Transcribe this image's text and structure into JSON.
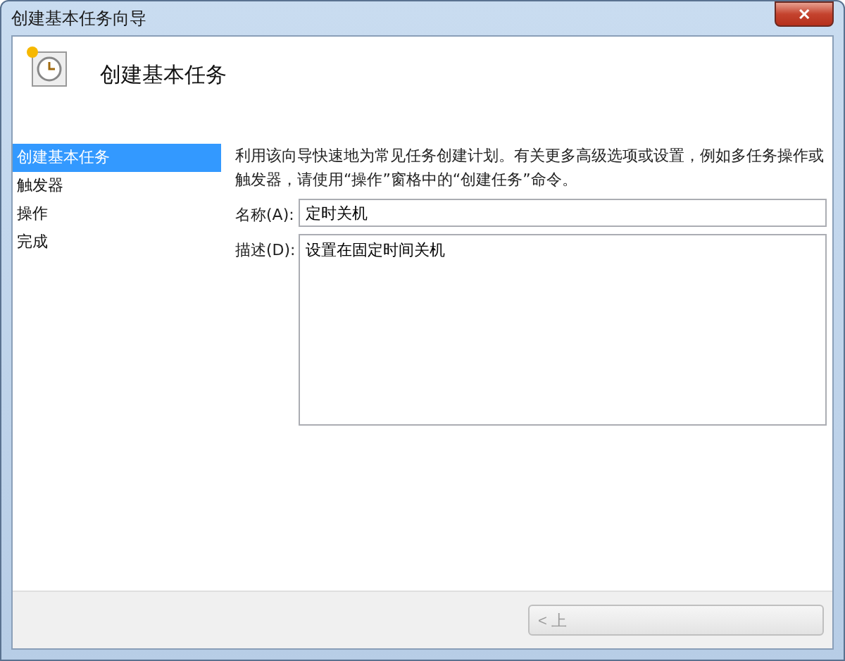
{
  "window": {
    "title": "创建基本任务向导",
    "close": "✕"
  },
  "header": {
    "title": "创建基本任务"
  },
  "steps": [
    {
      "label": "创建基本任务",
      "selected": true
    },
    {
      "label": "触发器",
      "selected": false
    },
    {
      "label": "操作",
      "selected": false
    },
    {
      "label": "完成",
      "selected": false
    }
  ],
  "intro": "利用该向导快速地为常见任务创建计划。有关更多高级选项或设置，例如多任务操作或触发器，请使用“操作”窗格中的“创建任务”命令。",
  "name_field": {
    "label": "名称(A):",
    "value": "定时关机"
  },
  "description_field": {
    "label": "描述(D):",
    "value": "设置在固定时间关机"
  },
  "buttons": [
    {
      "label": "< 上",
      "disabled": true
    }
  ]
}
